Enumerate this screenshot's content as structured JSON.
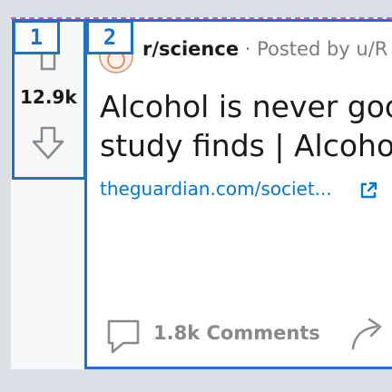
{
  "post": {
    "score": "12.9k",
    "subreddit": "r/science",
    "meta": "· Posted by u/R",
    "title_line1": "Alcohol is never goo",
    "title_line2": "study finds | Alcoho",
    "link": "theguardian.com/societ...",
    "comments": "1.8k Comments"
  },
  "annotations": {
    "box1_label": "1",
    "box2_label": "2"
  },
  "colors": {
    "accent_blue": "#1a73c9",
    "link_blue": "#0079d3",
    "dashed_border": "#e04fb2",
    "muted_gray": "#878a8c"
  },
  "icons": {
    "upvote": "upvote-arrow-icon",
    "downvote": "downvote-arrow-icon",
    "avatar": "subreddit-avatar-icon",
    "external": "external-link-icon",
    "comments": "comment-bubble-icon",
    "share": "share-arrow-icon"
  }
}
